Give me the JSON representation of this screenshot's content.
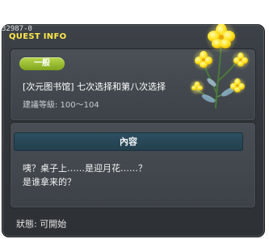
{
  "window": {
    "quest_id": "32987-0",
    "title": "QUEST INFO"
  },
  "quest": {
    "category_badge": "一般",
    "name": "[次元图书馆] 七次选择和第八次选择",
    "level": "建議等級: 100～104"
  },
  "content": {
    "header": "內容",
    "lines": [
      "咦？桌子上……是迎月花……？",
      "是谁拿来的？"
    ]
  },
  "status": "狀態: 可開始",
  "icons": {
    "decoration": "yellow-flower-icon"
  },
  "colors": {
    "title": "#ffe94a",
    "badge": "#9cc232",
    "content_header": "#2c5061",
    "window_bg": "#33373c"
  }
}
